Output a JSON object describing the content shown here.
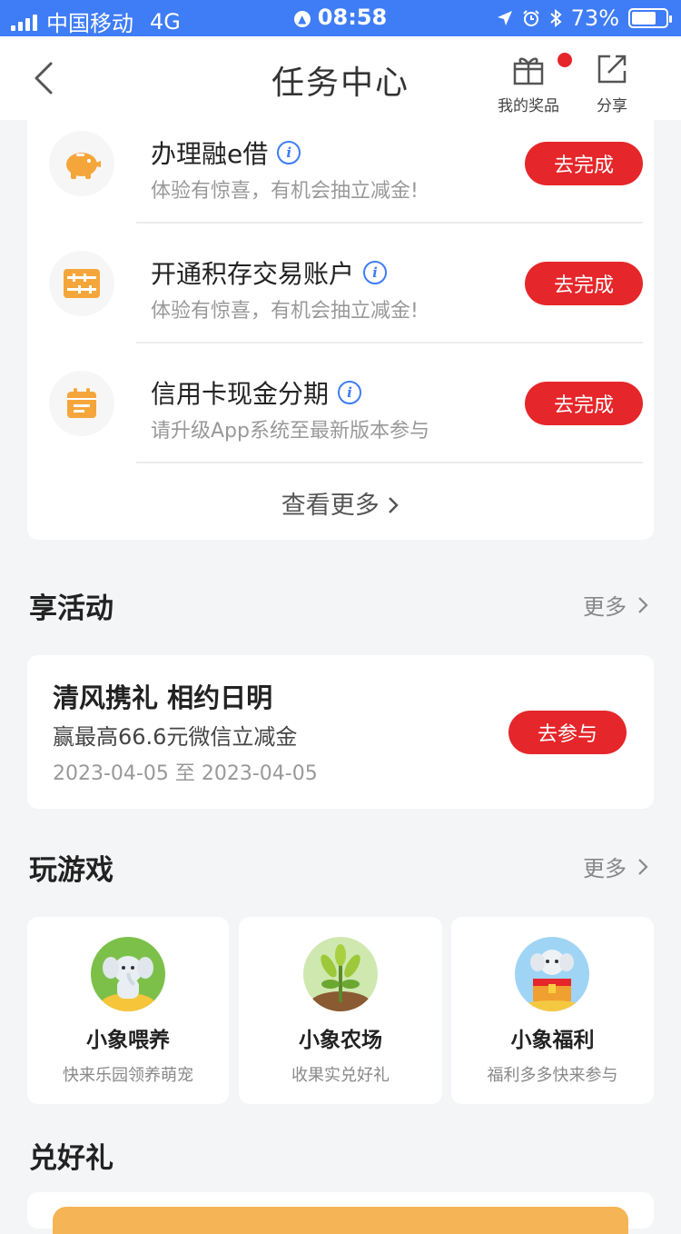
{
  "status_bar": {
    "carrier": "中国移动",
    "network": "4G",
    "time": "08:58",
    "battery": "73%",
    "battery_level": 0.73
  },
  "nav": {
    "title": "任务中心",
    "prizes_label": "我的奖品",
    "share_label": "分享"
  },
  "tasks": {
    "items": [
      {
        "title": "办理融e借",
        "subtitle": "体验有惊喜，有机会抽立减金!",
        "button": "去完成",
        "icon": "piggy-bank-icon"
      },
      {
        "title": "开通积存交易账户",
        "subtitle": "体验有惊喜，有机会抽立减金!",
        "button": "去完成",
        "icon": "abacus-icon"
      },
      {
        "title": "信用卡现金分期",
        "subtitle": "请升级App系统至最新版本参与",
        "button": "去完成",
        "icon": "calendar-icon"
      }
    ],
    "view_more": "查看更多"
  },
  "activities": {
    "title": "享活动",
    "more": "更多",
    "card": {
      "title": "清风携礼 相约日明",
      "desc": "赢最高66.6元微信立减金",
      "dates": "2023-04-05 至 2023-04-05",
      "button": "去参与"
    }
  },
  "games": {
    "title": "玩游戏",
    "more": "更多",
    "items": [
      {
        "name": "小象喂养",
        "desc": "快来乐园领养萌宠"
      },
      {
        "name": "小象农场",
        "desc": "收果实兑好礼"
      },
      {
        "name": "小象福利",
        "desc": "福利多多快来参与"
      }
    ]
  },
  "gifts": {
    "title": "兑好礼"
  },
  "colors": {
    "accent_blue": "#3f7df6",
    "button_red": "#e5262a",
    "icon_orange": "#f5a63a"
  }
}
